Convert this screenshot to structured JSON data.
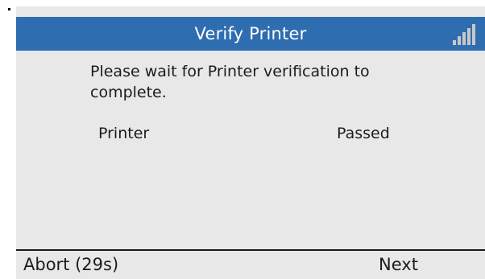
{
  "title_bar": {
    "title": "Verify Printer",
    "background_color": "#2f6db1",
    "text_color": "#ffffff",
    "signal_icon": "signal-strength-icon"
  },
  "content": {
    "message": "Please wait for Printer verification to complete.",
    "status_row": {
      "name": "Printer",
      "value": "Passed"
    }
  },
  "softkeys": {
    "left_label": "Abort (29s)",
    "right_label": "Next"
  }
}
